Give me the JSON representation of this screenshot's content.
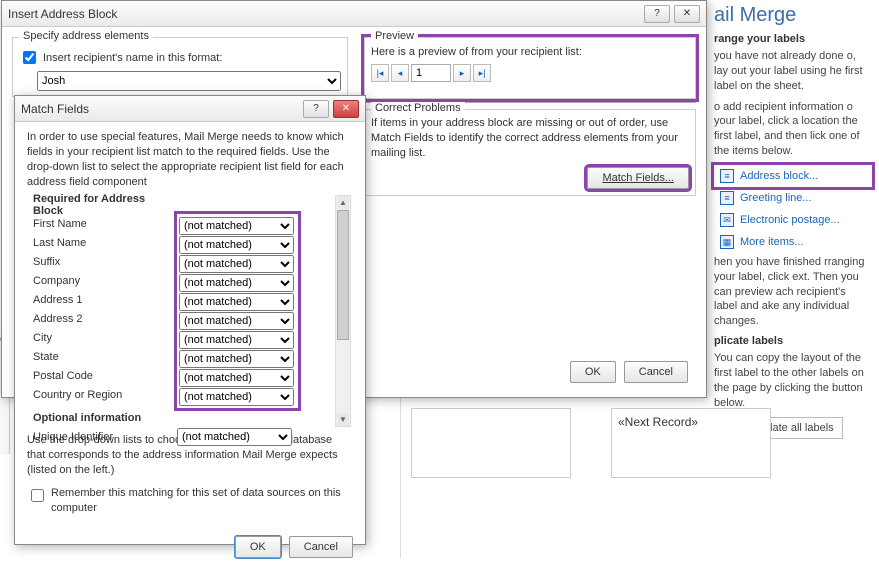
{
  "insertDialog": {
    "title": "Insert Address Block",
    "specifyHeading": "Specify address elements",
    "insertNameCheckboxLabel": "Insert recipient's name in this format:",
    "nameFormat": "Josh",
    "previewHeading": "Preview",
    "previewText": "Here is a preview of from your recipient list:",
    "recordNumber": "1",
    "correctHeading": "Correct Problems",
    "correctText": "If items in your address block are missing or out of order, use Match Fields to identify the correct address elements from your mailing list.",
    "matchFieldsBtn": "Match Fields...",
    "ok": "OK",
    "cancel": "Cancel",
    "helpGlyph": "?",
    "closeGlyph": "✕"
  },
  "matchDialog": {
    "title": "Match Fields",
    "intro": "In order to use special features, Mail Merge needs to know which fields in your recipient list match to the required fields. Use the drop-down list to select the appropriate recipient list field for each address field component",
    "requiredHeading": "Required for Address Block",
    "optionalHeading": "Optional information",
    "fields": {
      "firstName": "First Name",
      "lastName": "Last Name",
      "suffix": "Suffix",
      "company": "Company",
      "address1": "Address 1",
      "address2": "Address 2",
      "city": "City",
      "state": "State",
      "postal": "Postal Code",
      "country": "Country or Region",
      "uniqueId": "Unique Identifier"
    },
    "notMatched": "(not matched)",
    "helpText": "Use the drop-down lists to choose the field from your database that corresponds to the address information Mail Merge expects (listed on the left.)",
    "rememberLabel": "Remember this matching for this set of data sources on this computer",
    "ok": "OK",
    "cancel": "Cancel",
    "helpGlyph": "?",
    "closeGlyph": "✕"
  },
  "rightPanel": {
    "topTitle": "ail Merge",
    "arrangeHeading": "range your labels",
    "arrangeText1": "you have not already done o, lay out your label using he first label on the sheet.",
    "arrangeText2": "o add recipient information o your label, click a location the first label, and then lick one of the items below.",
    "addressBlock": "Address block...",
    "greetingLine": "Greeting line...",
    "electronicPostage": "Electronic postage...",
    "moreItems": "More items...",
    "finishedText": "hen you have finished rranging your label, click ext. Then you can preview ach recipient's label and ake any individual changes.",
    "replicateHeading": "plicate labels",
    "replicateText": "You can copy the layout of the first label to the other labels on the page by clicking the button below.",
    "updateBtn": "Update all labels"
  },
  "doc": {
    "nextRecord": "«Next Record»",
    "leftEdge": "ext"
  }
}
